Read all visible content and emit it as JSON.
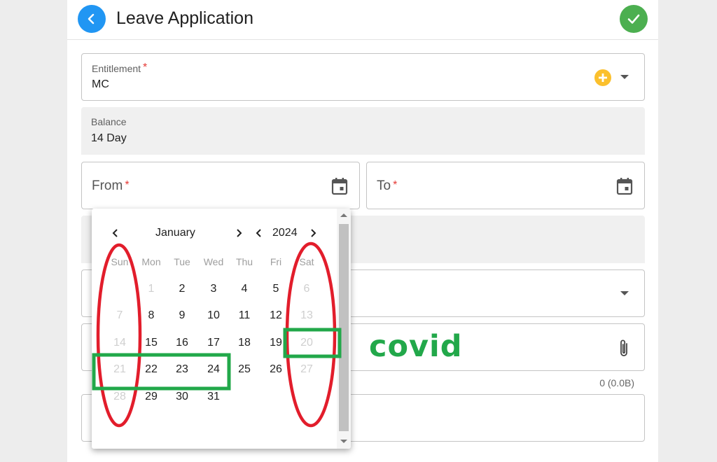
{
  "header": {
    "title": "Leave Application",
    "back_icon": "chevron-left-icon",
    "confirm_icon": "check-icon",
    "back_color": "#2196f3",
    "confirm_color": "#4caf50"
  },
  "form": {
    "entitlement": {
      "label": "Entitlement",
      "required": "*",
      "value": "MC",
      "add_icon": "add-circle-icon",
      "add_color": "#fbc02d"
    },
    "balance": {
      "label": "Balance",
      "value": "14 Day"
    },
    "from": {
      "label": "From",
      "required": "*",
      "icon": "calendar-icon"
    },
    "to": {
      "label": "To",
      "required": "*",
      "icon": "calendar-icon"
    },
    "attachment": {
      "icon": "paperclip-icon",
      "size": "0 (0.0B)"
    }
  },
  "calendar": {
    "month": "January",
    "year": "2024",
    "weekdays": [
      "Sun",
      "Mon",
      "Tue",
      "Wed",
      "Thu",
      "Fri",
      "Sat"
    ],
    "weeks": [
      [
        "",
        "1",
        "2",
        "3",
        "4",
        "5",
        "6"
      ],
      [
        "7",
        "8",
        "9",
        "10",
        "11",
        "12",
        "13"
      ],
      [
        "14",
        "15",
        "16",
        "17",
        "18",
        "19",
        "20"
      ],
      [
        "21",
        "22",
        "23",
        "24",
        "25",
        "26",
        "27"
      ],
      [
        "28",
        "29",
        "30",
        "31",
        "",
        "",
        ""
      ]
    ],
    "disabled": [
      "1",
      "6",
      "7",
      "13",
      "14",
      "20",
      "21",
      "27",
      "28"
    ]
  },
  "annotation": {
    "text": "covid",
    "text_color": "#22a84a",
    "ellipse_color": "#e21d2b",
    "box_color": "#22a84a"
  }
}
